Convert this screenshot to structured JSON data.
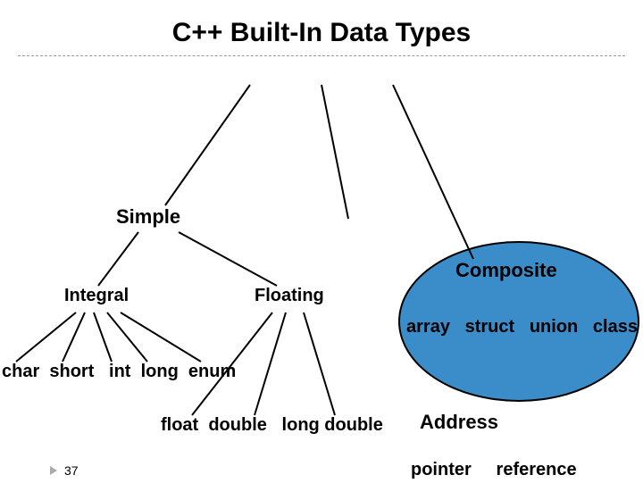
{
  "title": "C++  Built-In Data Types",
  "nodes": {
    "simple": "Simple",
    "composite": "Composite",
    "integral": "Integral",
    "floating": "Floating",
    "address": "Address"
  },
  "leaves": {
    "integral_types": "char  short   int  long  enum",
    "floating_types": "float  double   long double",
    "composite_types": "array   struct   union   class",
    "address_types": "pointer     reference"
  },
  "slide_number": "37"
}
